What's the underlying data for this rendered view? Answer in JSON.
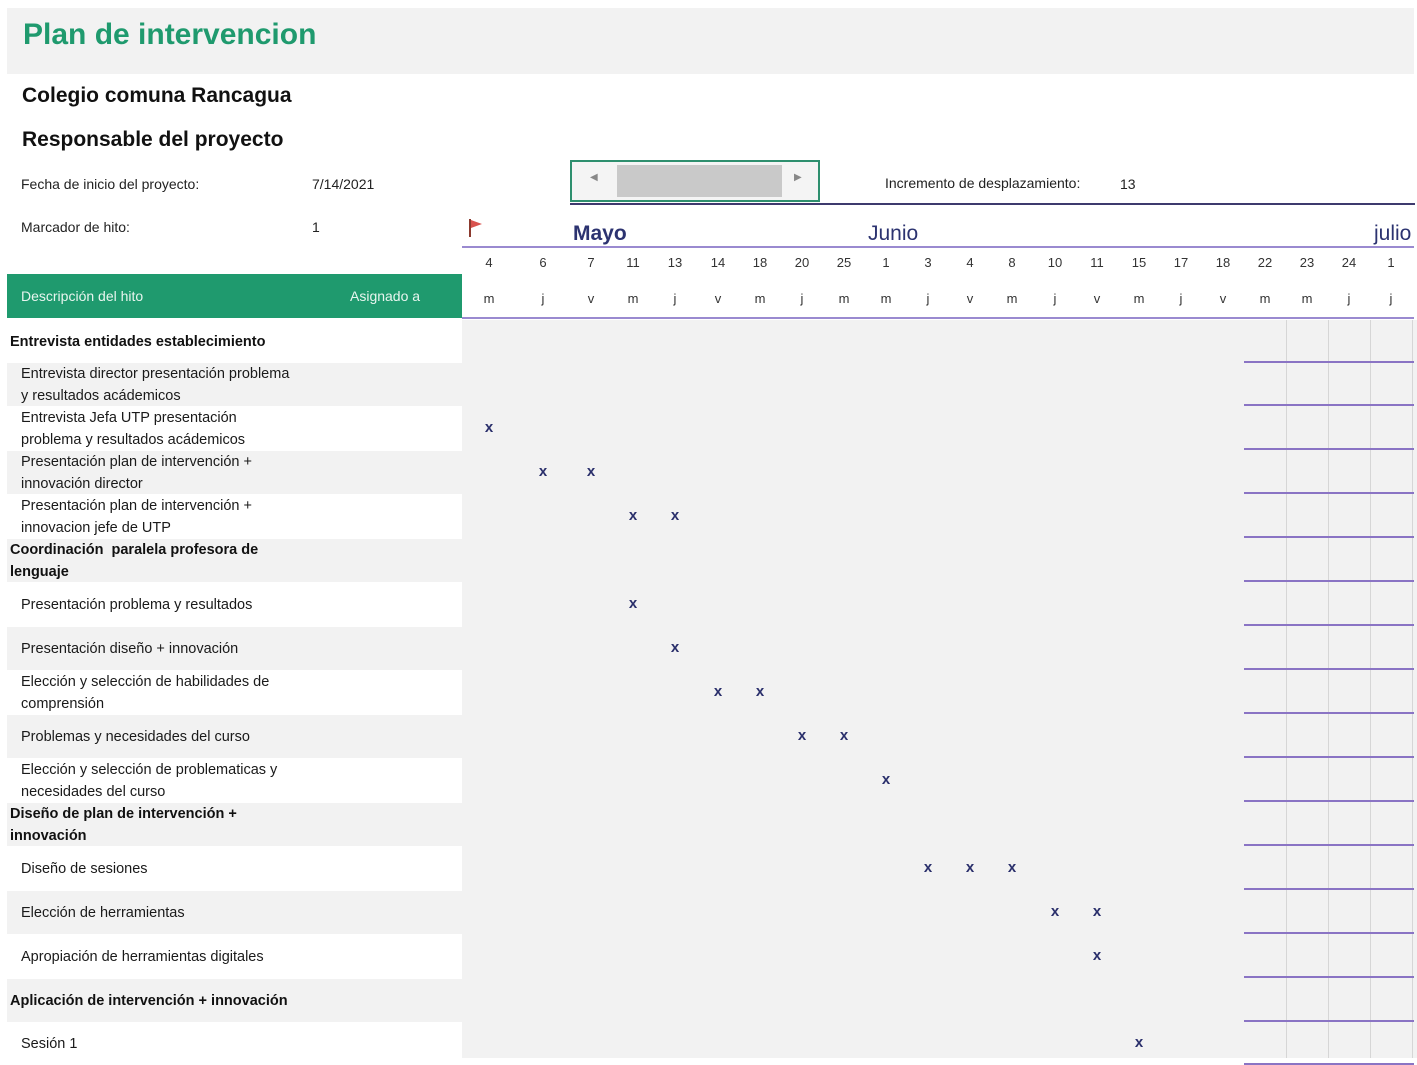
{
  "title": "Plan de intervencion",
  "school": "Colegio comuna Rancagua",
  "responsable": "Responsable del proyecto",
  "fecha_label": "Fecha de inicio del proyecto:",
  "fecha_value": "7/14/2021",
  "hito_label": "Marcador de hito:",
  "hito_value": "1",
  "incremento_label": "Incremento de desplazamiento:",
  "incremento_value": "13",
  "months": [
    "Mayo",
    "Junio",
    "julio"
  ],
  "header": {
    "descripcion": "Descripción del hito",
    "asignado": "Asignado a"
  },
  "days": [
    {
      "n": "4",
      "d": "m"
    },
    {
      "n": "6",
      "d": "j"
    },
    {
      "n": "7",
      "d": "v"
    },
    {
      "n": "11",
      "d": "m"
    },
    {
      "n": "13",
      "d": "j"
    },
    {
      "n": "14",
      "d": "v"
    },
    {
      "n": "18",
      "d": "m"
    },
    {
      "n": "20",
      "d": "j"
    },
    {
      "n": "25",
      "d": "m"
    },
    {
      "n": "1",
      "d": "m"
    },
    {
      "n": "3",
      "d": "j"
    },
    {
      "n": "4",
      "d": "v"
    },
    {
      "n": "8",
      "d": "m"
    },
    {
      "n": "10",
      "d": "j"
    },
    {
      "n": "11",
      "d": "v"
    },
    {
      "n": "15",
      "d": "m"
    },
    {
      "n": "17",
      "d": "j"
    },
    {
      "n": "18",
      "d": "v"
    },
    {
      "n": "22",
      "d": "m"
    },
    {
      "n": "23",
      "d": "m"
    },
    {
      "n": "24",
      "d": "j"
    },
    {
      "n": "1",
      "d": "j"
    }
  ],
  "rows": [
    {
      "text": "Entrevista entidades establecimiento",
      "cat": true,
      "marks": []
    },
    {
      "text": "Entrevista director presentación problema\ny resultados acádemicos",
      "cat": false,
      "marks": []
    },
    {
      "text": "Entrevista Jefa UTP presentación\nproblema y resultados acádemicos",
      "cat": false,
      "marks": [
        0
      ]
    },
    {
      "text": "Presentación plan de intervención +\ninnovación director",
      "cat": false,
      "marks": [
        1,
        2
      ]
    },
    {
      "text": "Presentación plan de intervención +\ninnovacion jefe de UTP",
      "cat": false,
      "marks": [
        3,
        4
      ]
    },
    {
      "text": "Coordinación  paralela profesora de\nlenguaje",
      "cat": true,
      "marks": []
    },
    {
      "text": "Presentación problema y resultados",
      "cat": false,
      "marks": [
        3
      ]
    },
    {
      "text": "Presentación diseño + innovación",
      "cat": false,
      "marks": [
        4
      ]
    },
    {
      "text": "Elección y selección de habilidades de\ncomprensión",
      "cat": false,
      "marks": [
        5,
        6
      ]
    },
    {
      "text": "Problemas y necesidades del curso",
      "cat": false,
      "marks": [
        7,
        8
      ]
    },
    {
      "text": "Elección y selección de problematicas y\nnecesidades del curso",
      "cat": false,
      "marks": [
        9
      ]
    },
    {
      "text": "Diseño de plan de intervención +\ninnovación",
      "cat": true,
      "marks": []
    },
    {
      "text": "Diseño de sesiones",
      "cat": false,
      "marks": [
        10,
        11,
        12
      ]
    },
    {
      "text": "Elección de herramientas",
      "cat": false,
      "marks": [
        13,
        14
      ]
    },
    {
      "text": "Apropiación de herramientas digitales",
      "cat": false,
      "marks": [
        14
      ]
    },
    {
      "text": "Aplicación de intervención + innovación",
      "cat": true,
      "marks": []
    },
    {
      "text": "Sesión 1",
      "cat": false,
      "marks": [
        15
      ]
    }
  ],
  "mark_char": "x",
  "colors": {
    "accent": "#1f9a6e",
    "dark_blue": "#2c3370",
    "purple_line": "#8a74c4",
    "flag": "#d9534f"
  }
}
